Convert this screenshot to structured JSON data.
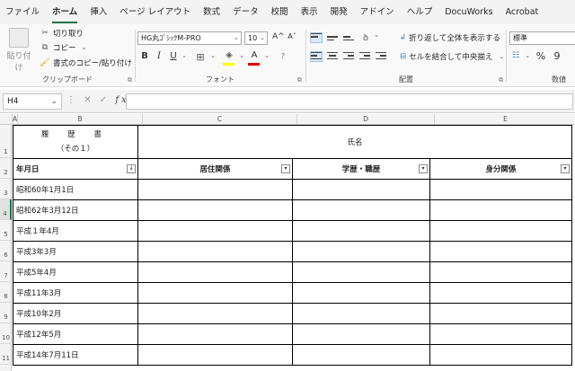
{
  "ribbon_tabs": [
    "ファイル",
    "ホーム",
    "挿入",
    "ページ レイアウト",
    "数式",
    "データ",
    "校閲",
    "表示",
    "開発",
    "アドイン",
    "ヘルプ",
    "DocuWorks",
    "Acrobat"
  ],
  "active_tab": "ホーム",
  "clipboard": {
    "paste_label": "貼り付け",
    "cut_label": "切り取り",
    "copy_label": "コピー",
    "format_painter_label": "書式のコピー/貼り付け",
    "group_label": "クリップボード"
  },
  "font": {
    "font_name": "HG丸ｺﾞｼｯｸM-PRO",
    "font_size": "10",
    "grow_label": "A^",
    "shrink_label": "Aˇ",
    "bold_label": "B",
    "italic_label": "I",
    "underline_label": "U",
    "group_label": "フォント"
  },
  "alignment": {
    "wrap_label": "折り返して全体を表示する",
    "merge_label": "セルを結合して中央揃え",
    "group_label": "配置"
  },
  "number": {
    "format_value": "標準",
    "percent_label": "%",
    "comma_label": "9",
    "group_label": "数値"
  },
  "formula_bar": {
    "name_box": "H4",
    "fx_label": "fx",
    "formula": ""
  },
  "columns": [
    "A",
    "B",
    "C",
    "D",
    "E"
  ],
  "rows": [
    "1",
    "2",
    "3",
    "4",
    "5",
    "6",
    "7",
    "8",
    "9",
    "10",
    "11"
  ],
  "sheet": {
    "title_line1": "履 歴 書",
    "title_line2": "（その１）",
    "name_header": "氏名",
    "headers": [
      "年月日",
      "居住関係",
      "学歴・職歴",
      "身分関係"
    ],
    "dates": [
      "昭和60年1月1日",
      "昭和62年3月12日",
      "平成１年4月",
      "平成3年3月",
      "平成5年4月",
      "平成11年3月",
      "平成10年2月",
      "平成12年5月",
      "平成14年7月11日"
    ]
  },
  "colors": {
    "accent_green": "#217346",
    "selection_green": "#217346"
  }
}
